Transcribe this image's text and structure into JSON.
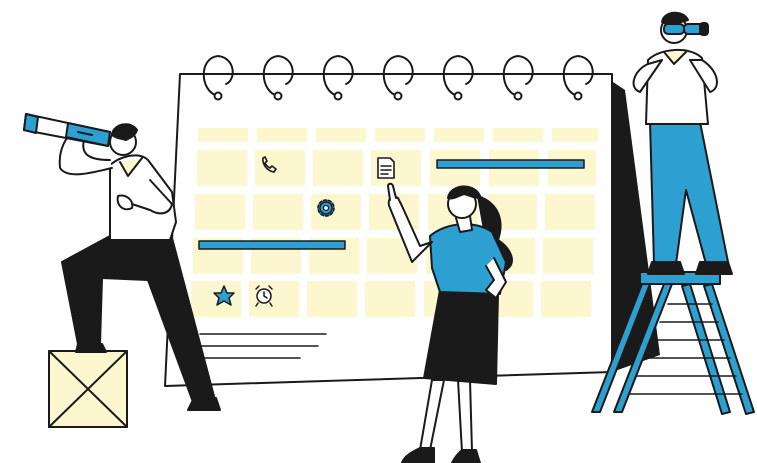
{
  "colors": {
    "ink": "#1a1a1a",
    "accent": "#2e9fd1",
    "cell": "#fdf7cf",
    "paper": "#ffffff"
  },
  "icons": [
    "phone-icon",
    "document-icon",
    "gear-icon",
    "star-icon",
    "alarm-clock-icon"
  ]
}
